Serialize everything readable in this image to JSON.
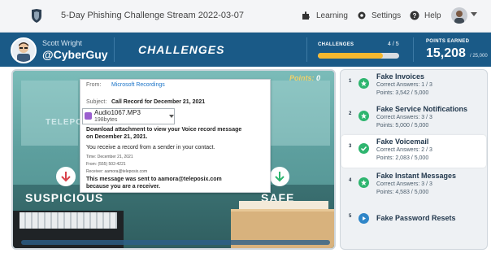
{
  "topbar": {
    "stream_title": "5-Day Phishing Challenge Stream 2022-03-07",
    "nav": {
      "learning": "Learning",
      "settings": "Settings",
      "help": "Help"
    }
  },
  "header": {
    "user_name": "Scott Wright",
    "user_handle": "@CyberGuy",
    "section_title": "CHALLENGES",
    "challenges_label": "CHALLENGES",
    "challenges_count": "4 / 5",
    "challenges_progress": 0.8,
    "points_label": "POINTS EARNED",
    "points_value": "15,208",
    "points_max": "/ 25,000"
  },
  "scene": {
    "points_tag": "Points:",
    "points_tag_value": "0",
    "telepos_text": "TELEPOS",
    "suspicious_label": "SUSPICIOUS",
    "safe_label": "SAFE"
  },
  "email": {
    "from_label": "From:",
    "from_value": "Microsoft Recordings",
    "subject_label": "Subject:",
    "subject_value": "Call Record for December 21, 2021",
    "attachment_name": "Audio1067.MP3",
    "attachment_size": "198bytes",
    "body_line1": "Download attachment to view your Voice record message",
    "body_line2": "on December 21, 2021.",
    "body_line3": "You receive a record from a sender in your contact.",
    "meta_time": "Time: December 21, 2021",
    "meta_from": "From: (555) 502-4221",
    "meta_receiver": "Receiver: aamora@teleposix.com",
    "footer_line1": "This message was sent to aamora@teleposix.com",
    "footer_line2": "because you are a receiver."
  },
  "sidebar": {
    "items": [
      {
        "num": "1",
        "title": "Fake Invoices",
        "answers": "Correct Answers: 1 / 3",
        "points": "Points: 3,542 / 5,000",
        "status": "done"
      },
      {
        "num": "2",
        "title": "Fake Service Notifications",
        "answers": "Correct Answers: 3 / 3",
        "points": "Points: 5,000 / 5,000",
        "status": "done"
      },
      {
        "num": "3",
        "title": "Fake Voicemail",
        "answers": "Correct Answers: 2 / 3",
        "points": "Points: 2,083 / 5,000",
        "status": "done"
      },
      {
        "num": "4",
        "title": "Fake Instant Messages",
        "answers": "Correct Answers: 3 / 3",
        "points": "Points: 4,583 / 5,000",
        "status": "done"
      },
      {
        "num": "5",
        "title": "Fake Password Resets",
        "answers": "",
        "points": "",
        "status": "todo"
      }
    ]
  },
  "colors": {
    "header_bg": "#1a5a87",
    "progress_fill": "#f5b82e",
    "done_green": "#2eb56f",
    "todo_blue": "#2f86c8"
  },
  "icons": {
    "learning": "puzzle-icon",
    "settings": "gear-icon",
    "help": "question-icon"
  }
}
